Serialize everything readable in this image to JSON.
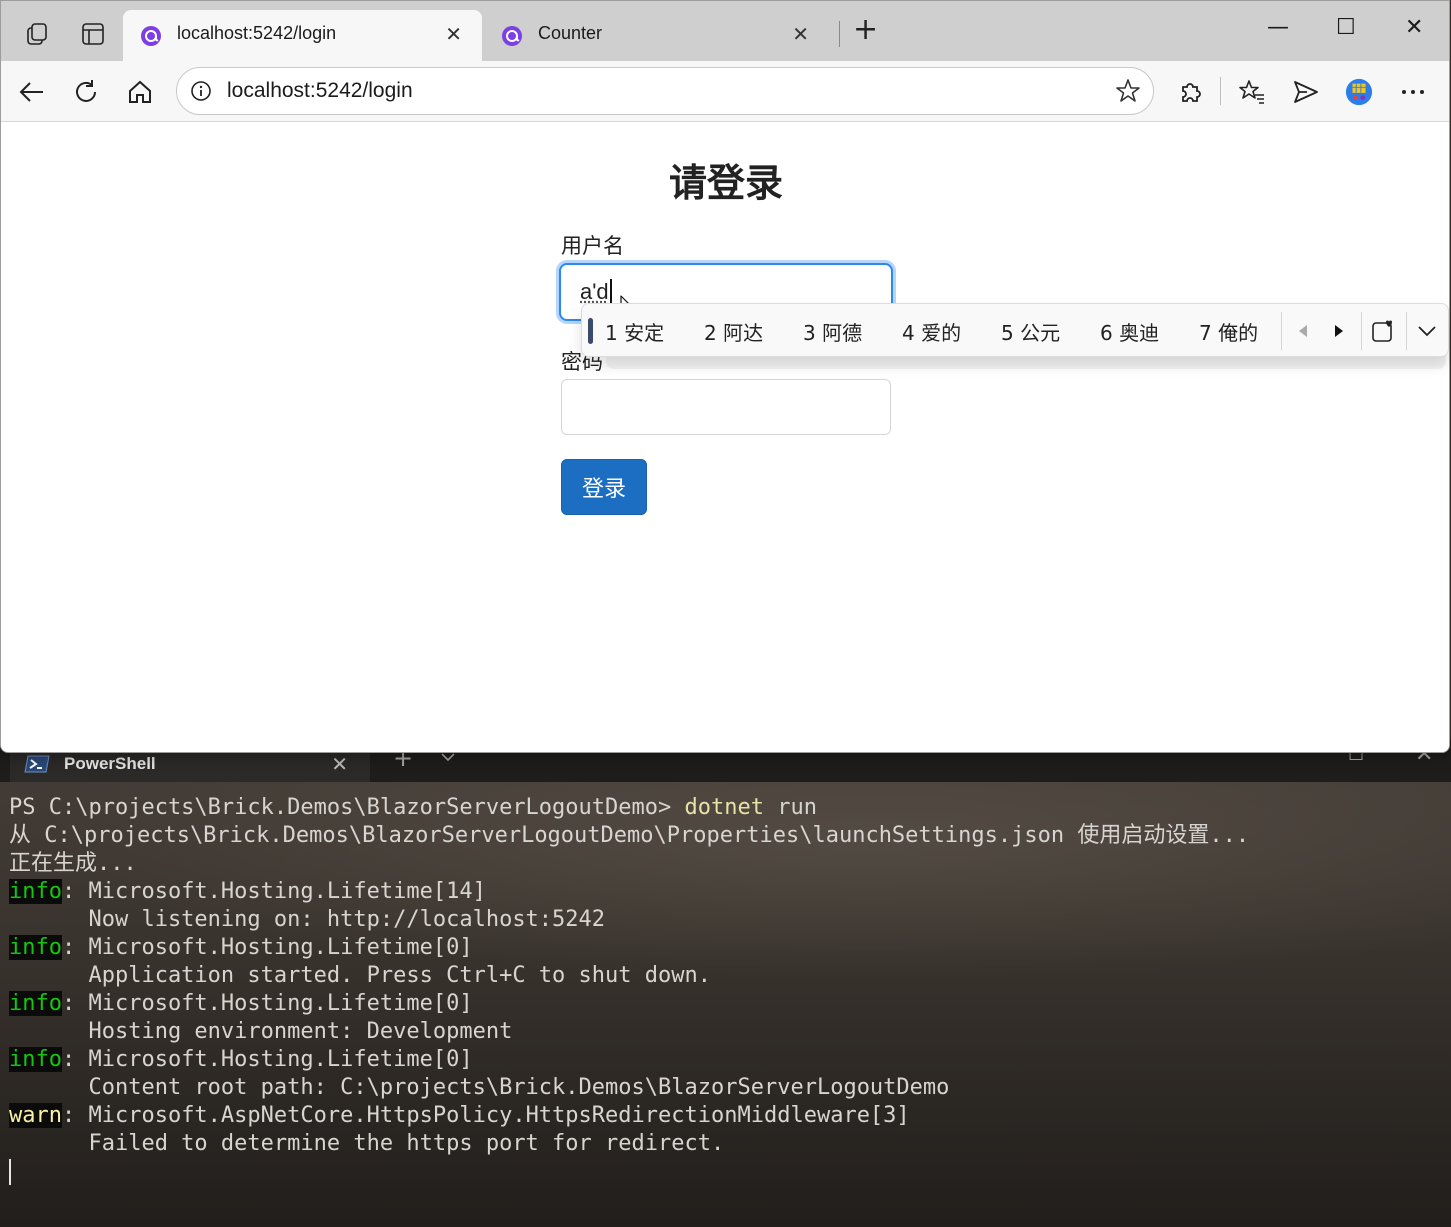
{
  "browser": {
    "tabs": [
      {
        "title": "localhost:5242/login",
        "active": true
      },
      {
        "title": "Counter",
        "active": false
      }
    ],
    "address": "localhost:5242/login"
  },
  "login": {
    "title": "请登录",
    "username_label": "用户名",
    "username_value": "a'd",
    "password_label": "密码",
    "submit_label": "登录"
  },
  "ime": {
    "candidates": [
      "1 安定",
      "2 阿达",
      "3 阿德",
      "4 爱的",
      "5 公元",
      "6 奥迪",
      "7 俺的"
    ]
  },
  "terminal": {
    "tab_title": "PowerShell",
    "lines": [
      {
        "prompt": "PS C:\\projects\\Brick.Demos\\BlazorServerLogoutDemo> ",
        "cmd": "dotnet",
        "rest": " run"
      },
      {
        "text": "从 C:\\projects\\Brick.Demos\\BlazorServerLogoutDemo\\Properties\\launchSettings.json 使用启动设置..."
      },
      {
        "text": "正在生成..."
      },
      {
        "tag": "info",
        "text": ": Microsoft.Hosting.Lifetime[14]"
      },
      {
        "text": "      Now listening on: http://localhost:5242"
      },
      {
        "tag": "info",
        "text": ": Microsoft.Hosting.Lifetime[0]"
      },
      {
        "text": "      Application started. Press Ctrl+C to shut down."
      },
      {
        "tag": "info",
        "text": ": Microsoft.Hosting.Lifetime[0]"
      },
      {
        "text": "      Hosting environment: Development"
      },
      {
        "tag": "info",
        "text": ": Microsoft.Hosting.Lifetime[0]"
      },
      {
        "text": "      Content root path: C:\\projects\\Brick.Demos\\BlazorServerLogoutDemo"
      },
      {
        "tag": "warn",
        "text": ": Microsoft.AspNetCore.HttpsPolicy.HttpsRedirectionMiddleware[3]"
      },
      {
        "text": "      Failed to determine the https port for redirect."
      }
    ]
  },
  "colors": {
    "accent": "#1b6ec2",
    "focus": "#2f88f0",
    "info": "#16c60c",
    "warn": "#f9f1a5"
  }
}
